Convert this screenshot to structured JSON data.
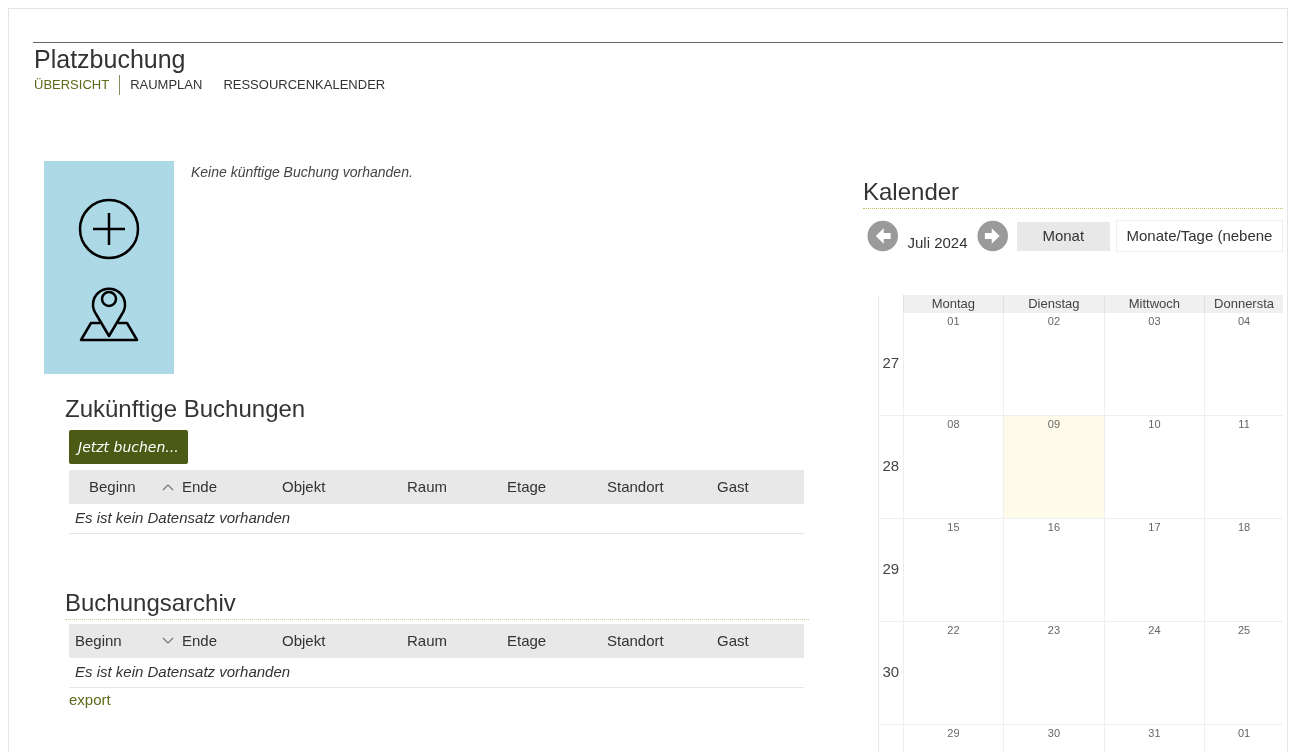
{
  "header": {
    "title": "Platzbuchung"
  },
  "tabs": [
    {
      "label": "ÜBERSICHT",
      "selected": true
    },
    {
      "label": "RAUMPLAN",
      "selected": false
    },
    {
      "label": "RESSOURCENKALENDER",
      "selected": false
    }
  ],
  "overview": {
    "message": "Keine künftige Buchung vorhanden."
  },
  "upcoming": {
    "title": "Zukünftige Buchungen",
    "button": "Jetzt buchen...",
    "sort_descending": false,
    "columns": [
      {
        "label": "Beginn",
        "sorted": true
      },
      {
        "label": "Ende",
        "sorted": false
      },
      {
        "label": "Objekt",
        "sorted": false
      },
      {
        "label": "Raum",
        "sorted": false
      },
      {
        "label": "Etage",
        "sorted": false
      },
      {
        "label": "Standort",
        "sorted": false
      },
      {
        "label": "Gast",
        "sorted": false
      }
    ],
    "empty": "Es ist kein Datensatz vorhanden"
  },
  "archive": {
    "title": "Buchungsarchiv",
    "sort_descending": true,
    "columns": [
      {
        "label": "Beginn",
        "sorted": true
      },
      {
        "label": "Ende",
        "sorted": false
      },
      {
        "label": "Objekt",
        "sorted": false
      },
      {
        "label": "Raum",
        "sorted": false
      },
      {
        "label": "Etage",
        "sorted": false
      },
      {
        "label": "Standort",
        "sorted": false
      },
      {
        "label": "Gast",
        "sorted": false
      }
    ],
    "empty": "Es ist kein Datensatz vorhanden",
    "export": "export"
  },
  "calendar": {
    "title": "Kalender",
    "month": "Juli 2024",
    "view_button": "Monat",
    "view_select": "Monate/Tage (nebene",
    "weekdays": [
      "Montag",
      "Dienstag",
      "Mittwoch",
      "Donnersta"
    ],
    "weeks": [
      {
        "number": "27",
        "days": [
          {
            "day": "01",
            "today": false
          },
          {
            "day": "02",
            "today": false
          },
          {
            "day": "03",
            "today": false
          },
          {
            "day": "04",
            "today": false
          }
        ]
      },
      {
        "number": "28",
        "days": [
          {
            "day": "08",
            "today": false
          },
          {
            "day": "09",
            "today": true
          },
          {
            "day": "10",
            "today": false
          },
          {
            "day": "11",
            "today": false
          }
        ]
      },
      {
        "number": "29",
        "days": [
          {
            "day": "15",
            "today": false
          },
          {
            "day": "16",
            "today": false
          },
          {
            "day": "17",
            "today": false
          },
          {
            "day": "18",
            "today": false
          }
        ]
      },
      {
        "number": "30",
        "days": [
          {
            "day": "22",
            "today": false
          },
          {
            "day": "23",
            "today": false
          },
          {
            "day": "24",
            "today": false
          },
          {
            "day": "25",
            "today": false
          }
        ]
      },
      {
        "days": [
          {
            "day": "29",
            "today": false
          },
          {
            "day": "30",
            "today": false
          },
          {
            "day": "31",
            "today": false
          },
          {
            "day": "01",
            "today": false
          }
        ]
      }
    ]
  }
}
